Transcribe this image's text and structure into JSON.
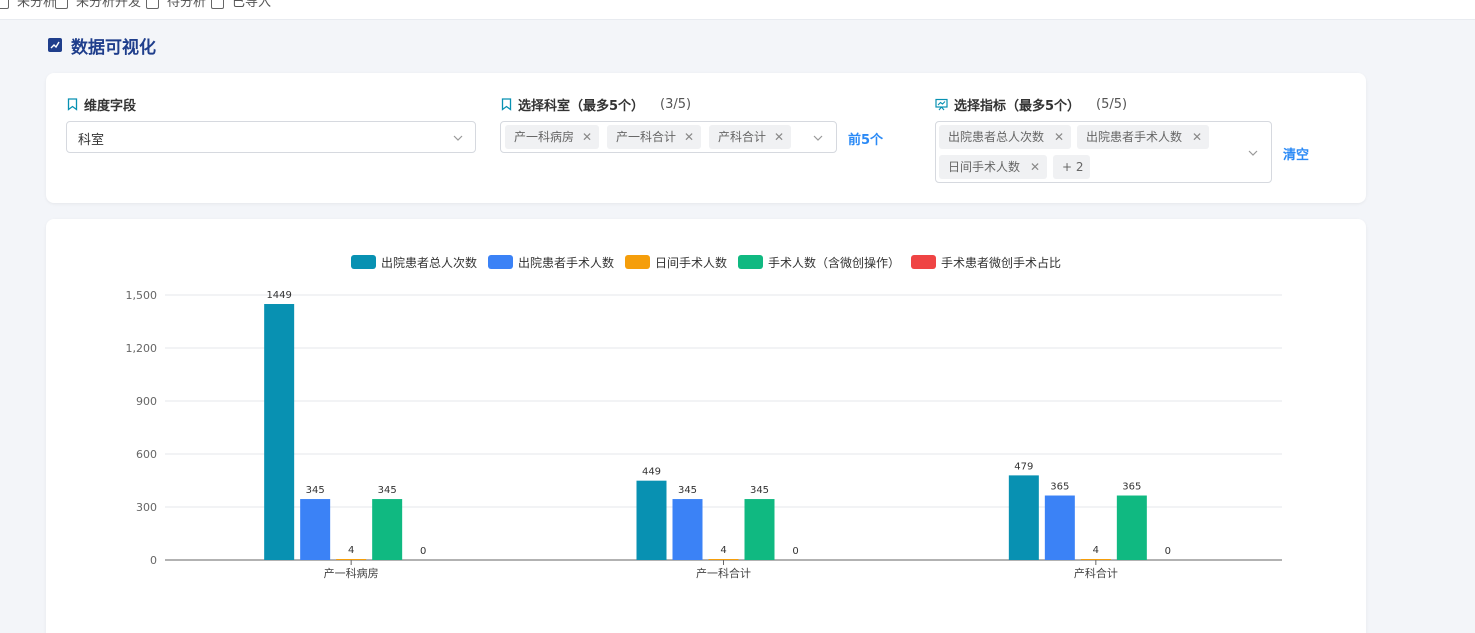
{
  "topbar": {
    "items": [
      {
        "label": "未分析"
      },
      {
        "label": "未分析开发"
      },
      {
        "label": "待分析"
      },
      {
        "label": "已导入"
      }
    ]
  },
  "page": {
    "title": "数据可视化"
  },
  "filters": {
    "dimension": {
      "label": "维度字段",
      "value": "科室"
    },
    "departments": {
      "label": "选择科室（最多5个）",
      "count": "(3/5)",
      "tags": [
        "产一科病房",
        "产一科合计",
        "产科合计"
      ],
      "action": "前5个"
    },
    "metrics": {
      "label": "选择指标（最多5个）",
      "count": "(5/5)",
      "tags": [
        "出院患者总人次数",
        "出院患者手术人数",
        "日间手术人数"
      ],
      "more": "+ 2",
      "action": "清空"
    }
  },
  "colors": {
    "series": [
      "#0891b2",
      "#3b82f6",
      "#f59e0b",
      "#10b981",
      "#ef4444"
    ],
    "title": "#1f3e8c",
    "link": "#2b8af6"
  },
  "chart_data": {
    "type": "bar",
    "categories": [
      "产一科病房",
      "产一科合计",
      "产科合计"
    ],
    "series": [
      {
        "name": "出院患者总人次数",
        "values": [
          1449,
          449,
          479
        ]
      },
      {
        "name": "出院患者手术人数",
        "values": [
          345,
          345,
          365
        ]
      },
      {
        "name": "日间手术人数",
        "values": [
          4,
          4,
          4
        ]
      },
      {
        "name": "手术人数（含微创操作）",
        "values": [
          345,
          345,
          365
        ]
      },
      {
        "name": "手术患者微创手术占比",
        "values": [
          0,
          0,
          0
        ]
      }
    ],
    "ylim": [
      0,
      1500
    ],
    "yticks": [
      "0",
      "300",
      "600",
      "900",
      "1,200",
      "1,500"
    ],
    "grid": true,
    "legend": "top-center"
  }
}
